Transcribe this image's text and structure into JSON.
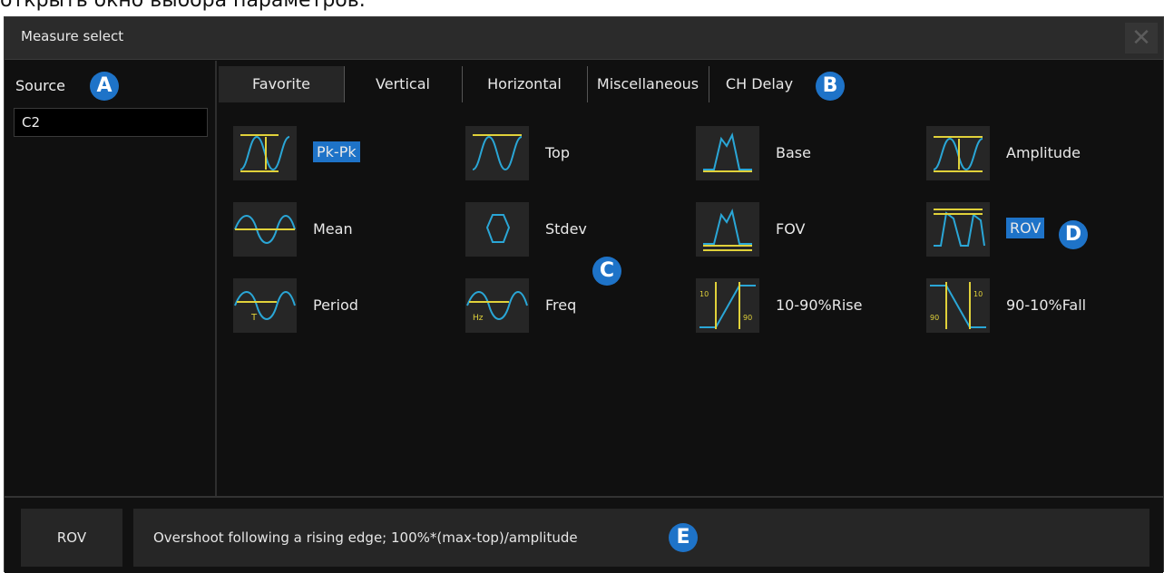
{
  "caption": "открыть окно выбора параметров.",
  "window": {
    "title": "Measure select",
    "close_icon": "close-icon"
  },
  "source": {
    "label": "Source",
    "value": "C2"
  },
  "tabs": [
    {
      "label": "Favorite",
      "active": true
    },
    {
      "label": "Vertical"
    },
    {
      "label": "Horizontal"
    },
    {
      "label": "Miscellaneous"
    },
    {
      "label": "CH Delay"
    }
  ],
  "items": [
    {
      "label": "Pk-Pk",
      "icon": "pkpk-icon",
      "selected": true
    },
    {
      "label": "Top",
      "icon": "top-icon"
    },
    {
      "label": "Base",
      "icon": "base-icon"
    },
    {
      "label": "Amplitude",
      "icon": "amplitude-icon"
    },
    {
      "label": "Mean",
      "icon": "mean-icon"
    },
    {
      "label": "Stdev",
      "icon": "stdev-icon"
    },
    {
      "label": "FOV",
      "icon": "fov-icon"
    },
    {
      "label": "ROV",
      "icon": "rov-icon",
      "selected": true
    },
    {
      "label": "Period",
      "icon": "period-icon"
    },
    {
      "label": "Freq",
      "icon": "freq-icon"
    },
    {
      "label": "10-90%Rise",
      "icon": "rise-icon"
    },
    {
      "label": "90-10%Fall",
      "icon": "fall-icon"
    }
  ],
  "markers": {
    "a": "A",
    "b": "B",
    "c": "C",
    "d": "D",
    "e": "E"
  },
  "footer": {
    "name": "ROV",
    "description": "Overshoot following a rising edge; 100%*(max-top)/amplitude"
  },
  "colors": {
    "accent": "#1e73c8",
    "wave": "#2aa6d6",
    "marker_line": "#e0d13a"
  }
}
